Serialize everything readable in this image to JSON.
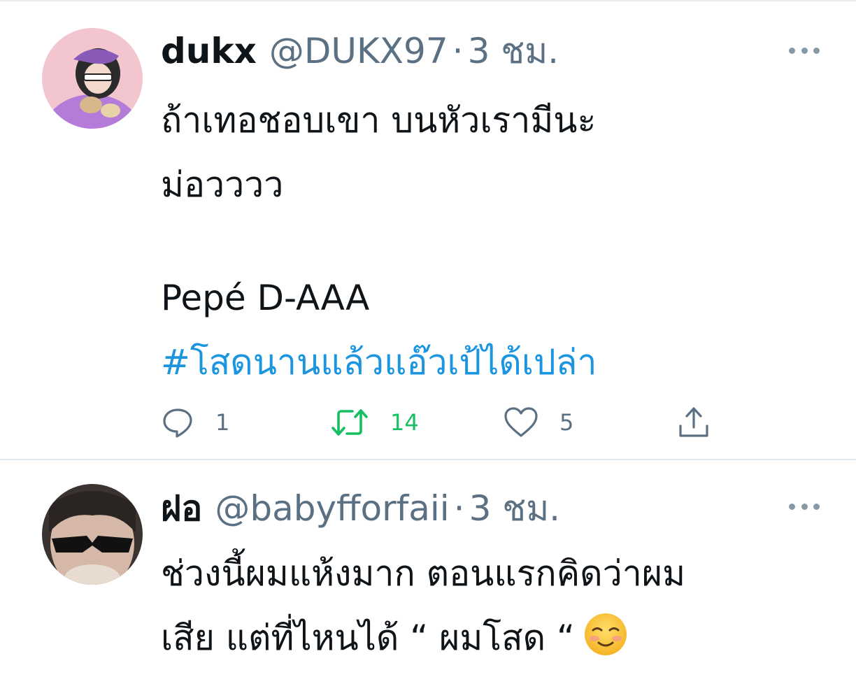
{
  "tweets": [
    {
      "display_name": "dukx",
      "handle": "@DUKX97",
      "separator": "·",
      "time": "3 ชม.",
      "body_lines": [
        "ถ้าเทอชอบเขา บนหัวเรามีนะ",
        "ม่อวววว",
        "",
        "Pepé D-AAA"
      ],
      "hashtag": "#โสดนานแล้วแอ๊วเป้ได้เปล่า",
      "actions": {
        "replies": "1",
        "retweets": "14",
        "likes": "5"
      },
      "retweeted_color": "#17bf63"
    },
    {
      "display_name": "ฝอ",
      "handle": "@babyfforfaii",
      "separator": "·",
      "time": "3 ชม.",
      "body_lines": [
        "ช่วงนี้ผมแห้งมาก ตอนแรกคิดว่าผม",
        "เสีย แต่ที่ไหนได้ “ ผมโสด “"
      ],
      "emoji": "smiling-face-emoji"
    }
  ],
  "colors": {
    "hashtag": "#1b95e0",
    "secondary_text": "#5b7083",
    "retweet_green": "#17bf63"
  }
}
